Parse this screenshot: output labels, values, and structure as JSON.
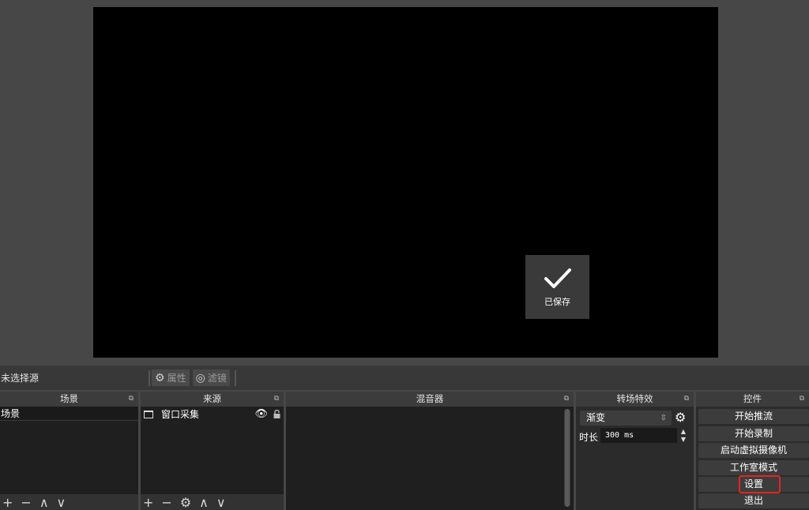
{
  "preview": {
    "toast_label": "已保存"
  },
  "context_bar": {
    "source_label": "未选择源",
    "properties_label": "属性",
    "filters_label": "滤镜"
  },
  "docks": {
    "scenes": {
      "title": "场景",
      "items": [
        "场景"
      ]
    },
    "sources": {
      "title": "来源",
      "items": [
        "窗口采集"
      ]
    },
    "mixer": {
      "title": "混音器"
    },
    "transitions": {
      "title": "转场特效",
      "selected": "渐变",
      "duration_label": "时长",
      "duration_value": "300 ms"
    },
    "controls": {
      "title": "控件",
      "buttons": [
        "开始推流",
        "开始录制",
        "启动虚拟摄像机",
        "工作室模式",
        "设置",
        "退出"
      ]
    }
  },
  "colors": {
    "highlight": "#e0261e",
    "background": "#474747",
    "canvas": "#000000"
  }
}
